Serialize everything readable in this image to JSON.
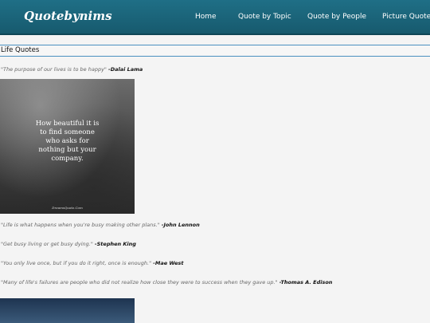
{
  "nav": {
    "logo": "Quotebynims",
    "links": [
      "Home",
      "Quote by Topic",
      "Quote by People",
      "Picture Quote"
    ]
  },
  "section": {
    "title": "Life Quotes"
  },
  "quotes": [
    {
      "text": "\"The purpose of our lives is to be happy\"",
      "author": "-Dalai Lama"
    },
    {
      "text": "\"Life is what happens when you're busy making other plans.\"",
      "author": "-John Lennon"
    },
    {
      "text": "\"Get busy living or get busy dying.\"",
      "author": "-Stephen King"
    },
    {
      "text": "\"You only live once, but if you do it right, once is enough.\"",
      "author": "-Mae West"
    },
    {
      "text": "\"Many of life's failures are people who did not realize how close they were to success when they gave up.\"",
      "author": "-Thomas A. Edison"
    }
  ],
  "picture_quote": {
    "text": "How beautiful it is\nto find someone\nwho asks for\nnothing but your\ncompany.",
    "credit": "DreamsQuote.Com"
  }
}
